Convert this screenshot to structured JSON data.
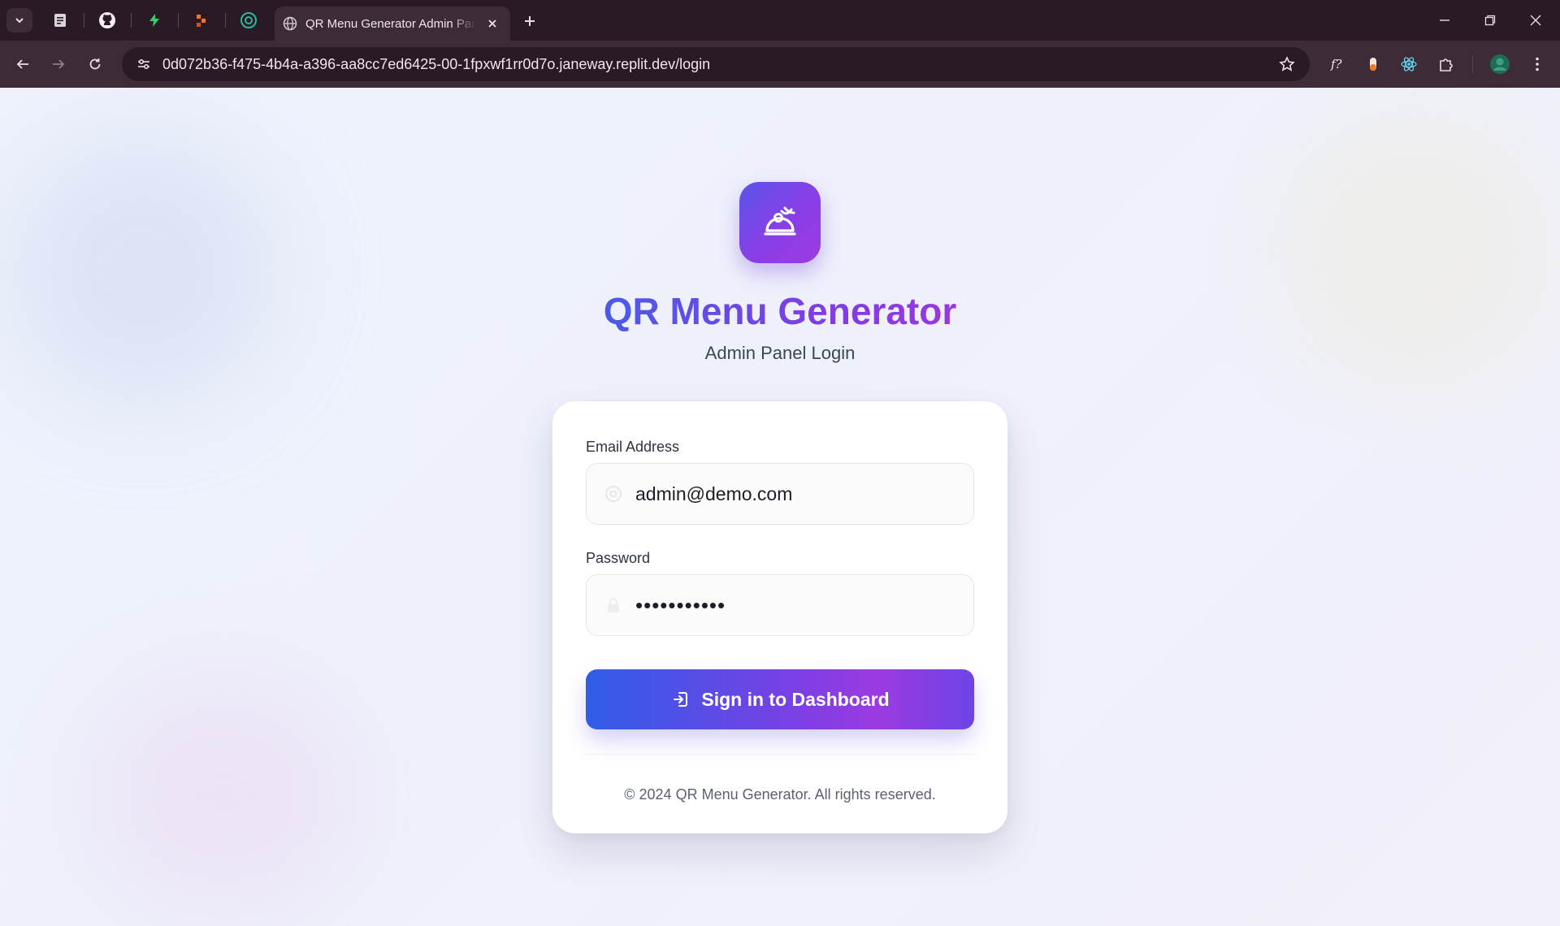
{
  "browser": {
    "active_tab_title": "QR Menu Generator Admin Panel",
    "url": "0d072b36-f475-4b4a-a396-aa8cc7ed6425-00-1fpxwf1rr0d7o.janeway.replit.dev/login",
    "pinned_tabs": [
      "docs-icon",
      "github-icon",
      "bolt-icon",
      "flow-icon",
      "chatgpt-icon"
    ],
    "extensions": [
      "function-icon",
      "capsule-icon",
      "react-icon",
      "puzzle-icon"
    ]
  },
  "app": {
    "title": "QR Menu Generator",
    "subtitle": "Admin Panel Login",
    "brand_colors": {
      "start": "#4a5be6",
      "end": "#9a36df"
    }
  },
  "form": {
    "email_label": "Email Address",
    "email_value": "admin@demo.com",
    "password_label": "Password",
    "password_mask": "•••••••••••",
    "submit_label": "Sign in to Dashboard"
  },
  "footer": {
    "copyright": "© 2024 QR Menu Generator. All rights reserved."
  }
}
